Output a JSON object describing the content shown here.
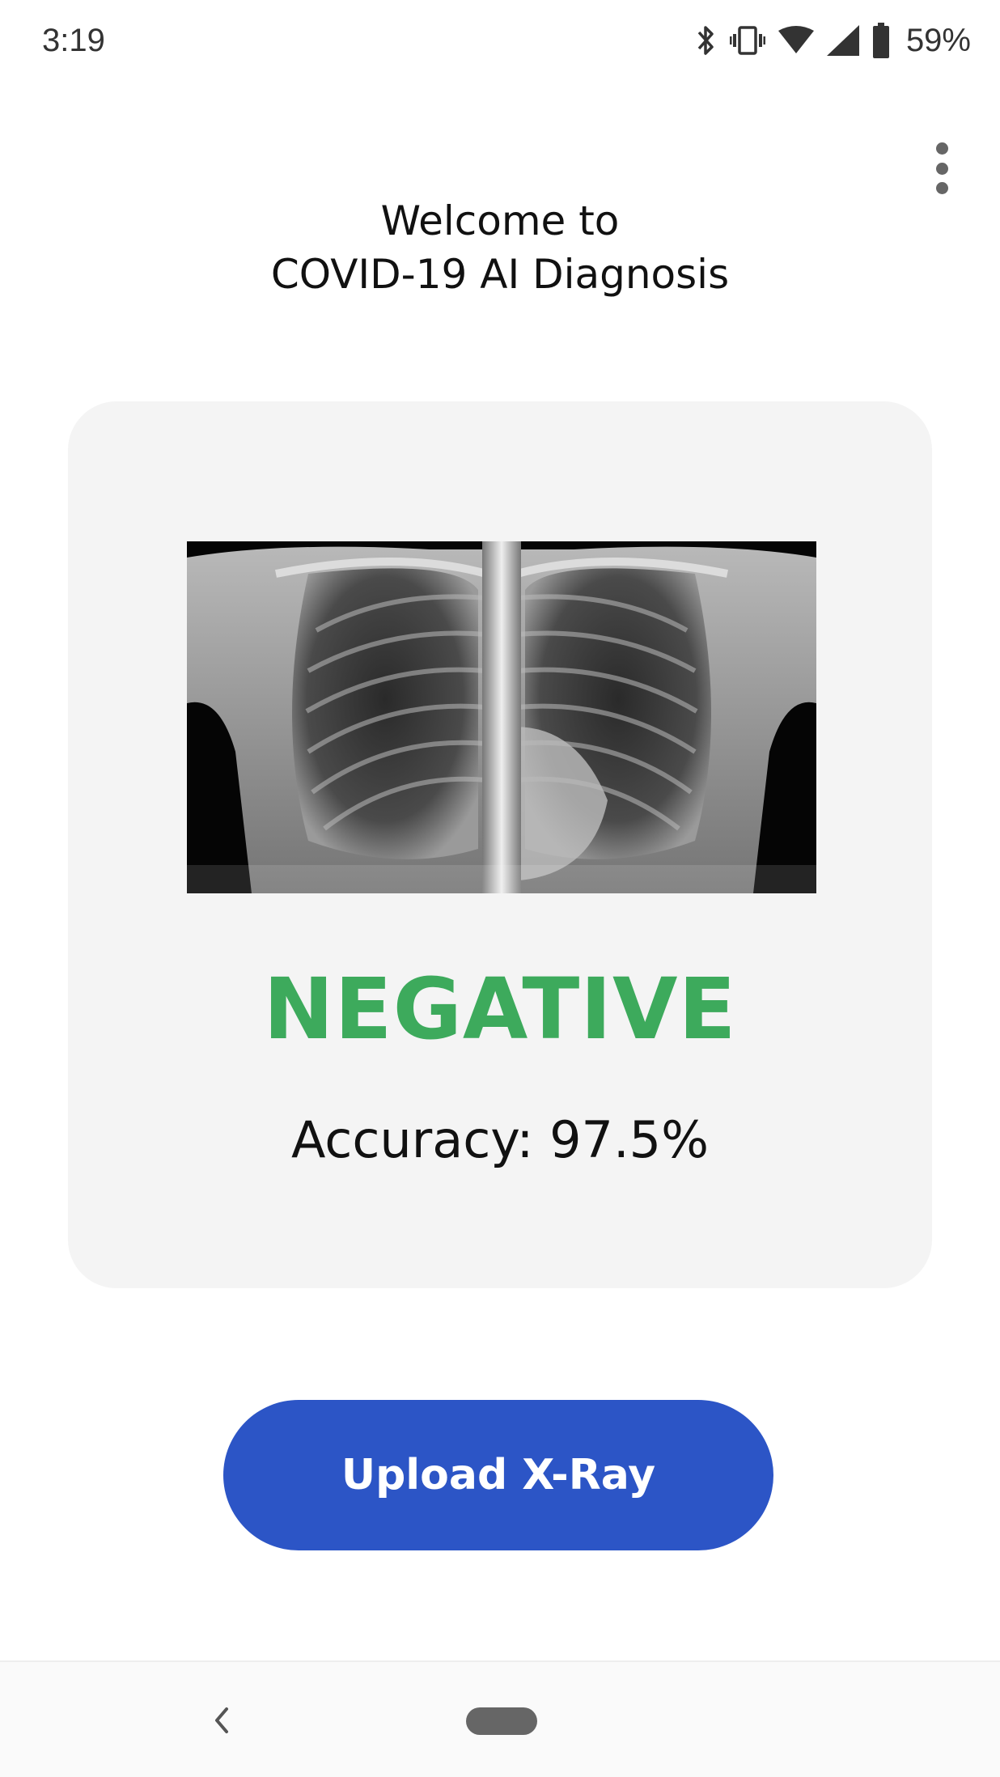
{
  "status_bar": {
    "time": "3:19",
    "icons": [
      "bluetooth-icon",
      "vibrate-icon",
      "wifi-icon",
      "cell-signal-icon",
      "battery-icon"
    ],
    "battery_percent": "59%"
  },
  "header": {
    "title_line1": "Welcome to",
    "title_line2": "COVID-19 AI Diagnosis",
    "menu_icon": "more-vert-icon"
  },
  "result": {
    "label": "NEGATIVE",
    "label_color": "#3daa5c",
    "accuracy_text": "Accuracy: 97.5%"
  },
  "actions": {
    "upload_label": "Upload X-Ray",
    "button_color": "#2c55c6"
  },
  "nav": {
    "back_icon": "back-chevron-icon",
    "home_icon": "home-pill-icon"
  }
}
